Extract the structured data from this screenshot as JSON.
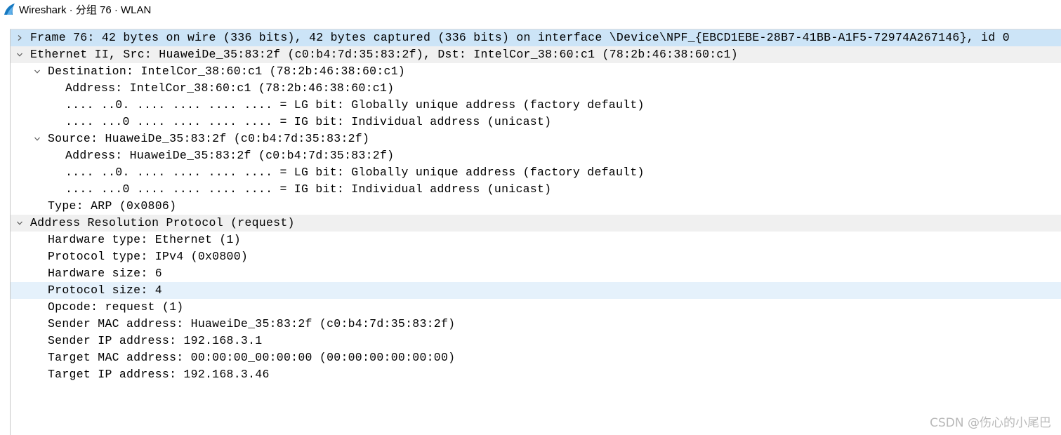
{
  "window": {
    "title": "Wireshark · 分组 76 · WLAN"
  },
  "tree": {
    "frame": "Frame 76: 42 bytes on wire (336 bits), 42 bytes captured (336 bits) on interface \\Device\\NPF_{EBCD1EBE-28B7-41BB-A1F5-72974A267146}, id 0",
    "ethernet": "Ethernet II, Src: HuaweiDe_35:83:2f (c0:b4:7d:35:83:2f), Dst: IntelCor_38:60:c1 (78:2b:46:38:60:c1)",
    "destination": "Destination: IntelCor_38:60:c1 (78:2b:46:38:60:c1)",
    "dst_address": "Address: IntelCor_38:60:c1 (78:2b:46:38:60:c1)",
    "dst_lg_bit": ".... ..0. .... .... .... .... = LG bit: Globally unique address (factory default)",
    "dst_ig_bit": ".... ...0 .... .... .... .... = IG bit: Individual address (unicast)",
    "source": "Source: HuaweiDe_35:83:2f (c0:b4:7d:35:83:2f)",
    "src_address": "Address: HuaweiDe_35:83:2f (c0:b4:7d:35:83:2f)",
    "src_lg_bit": ".... ..0. .... .... .... .... = LG bit: Globally unique address (factory default)",
    "src_ig_bit": ".... ...0 .... .... .... .... = IG bit: Individual address (unicast)",
    "eth_type": "Type: ARP (0x0806)",
    "arp": "Address Resolution Protocol (request)",
    "hw_type": "Hardware type: Ethernet (1)",
    "proto_type": "Protocol type: IPv4 (0x0800)",
    "hw_size": "Hardware size: 6",
    "proto_size": "Protocol size: 4",
    "opcode": "Opcode: request (1)",
    "sender_mac": "Sender MAC address: HuaweiDe_35:83:2f (c0:b4:7d:35:83:2f)",
    "sender_ip": "Sender IP address: 192.168.3.1",
    "target_mac": "Target MAC address: 00:00:00_00:00:00 (00:00:00:00:00:00)",
    "target_ip": "Target IP address: 192.168.3.46"
  },
  "watermark": "CSDN @伤心的小尾巴",
  "colors": {
    "selected_row": "#cce4f7",
    "group_row": "#f0f0f0",
    "hover_row": "#e5f1fb",
    "app_icon": "#1679c1"
  },
  "icons": {
    "app": "wireshark-fin-icon",
    "collapsed": "chevron-right-icon",
    "expanded": "chevron-down-icon"
  }
}
